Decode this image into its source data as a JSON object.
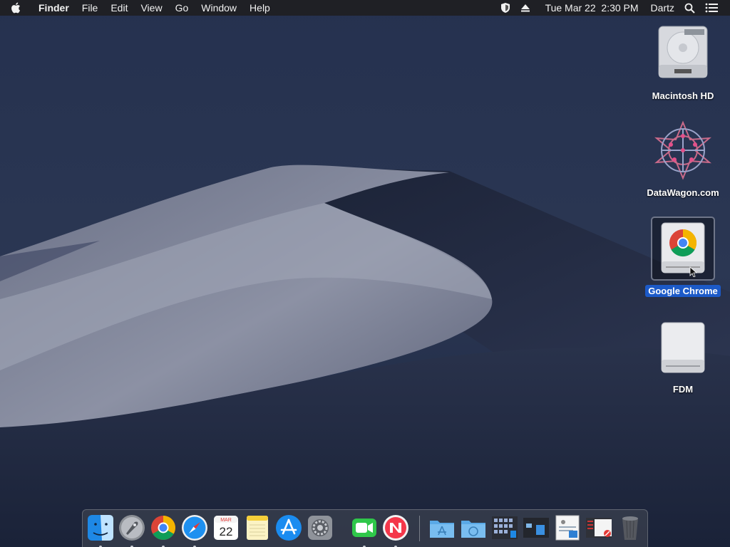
{
  "menubar": {
    "app_name": "Finder",
    "menus": [
      "File",
      "Edit",
      "View",
      "Go",
      "Window",
      "Help"
    ],
    "clock": "Tue Mar 22  2:30 PM",
    "user": "Dartz",
    "icons": [
      "apple-icon",
      "shield-icon",
      "eject-icon",
      "search-icon",
      "notification-center-icon"
    ]
  },
  "desktop": {
    "items": [
      {
        "label": "Macintosh HD",
        "icon": "hard-drive-icon",
        "selected": false
      },
      {
        "label": "DataWagon.com",
        "icon": "network-globe-icon",
        "selected": false
      },
      {
        "label": "Google Chrome",
        "icon": "chrome-disk-image-icon",
        "selected": true
      },
      {
        "label": "FDM",
        "icon": "external-drive-icon",
        "selected": false
      }
    ]
  },
  "dock": {
    "apps": [
      "Finder",
      "Launchpad",
      "Google Chrome",
      "Safari",
      "Calendar",
      "Notes",
      "App Store",
      "System Preferences",
      "FaceTime",
      "News"
    ],
    "calendar": {
      "month": "MAR",
      "day": "22"
    },
    "running": [
      "Finder",
      "Launchpad",
      "Google Chrome",
      "Safari",
      "FaceTime",
      "News"
    ],
    "folders": [
      "Applications folder",
      "Downloads folder",
      "Documents stack",
      "Desktop stack",
      "Recent stack 1",
      "Recent stack 2",
      "Trash"
    ]
  },
  "colors": {
    "menubar": "#1e1e22",
    "selection": "#1c5ac8",
    "sky": "#1f2a44",
    "dune": "#a3a8b8"
  }
}
